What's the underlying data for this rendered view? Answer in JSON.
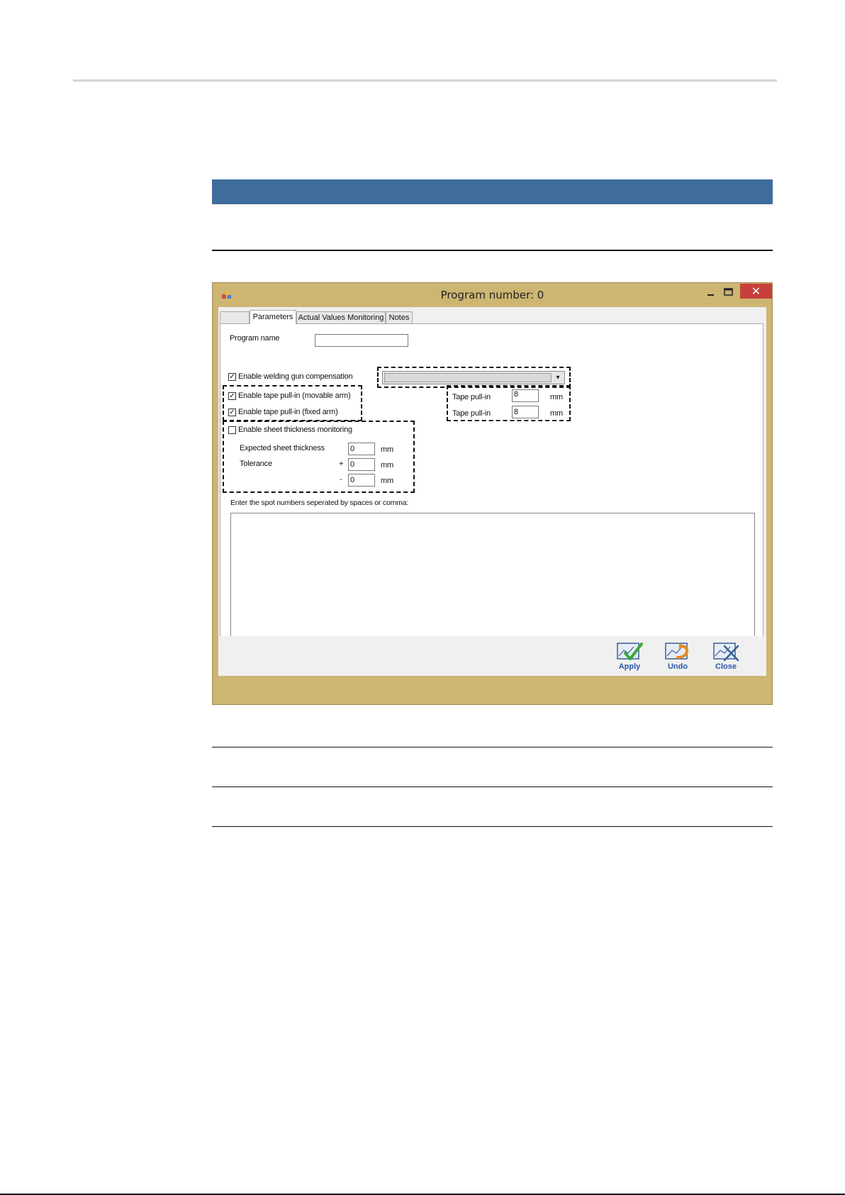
{
  "window": {
    "title": "Program number: 0",
    "close_glyph": "✕"
  },
  "tabs": [
    {
      "label": ""
    },
    {
      "label": "Parameters"
    },
    {
      "label": "Actual Values Monitoring"
    },
    {
      "label": "Notes"
    }
  ],
  "form": {
    "program_name_label": "Program name",
    "program_name_value": "",
    "welding_gun_label": "Enable welding gun compensation",
    "welding_gun_checked": true,
    "tape_movable_label": "Enable tape pull-in (movable arm)",
    "tape_movable_checked": true,
    "tape_fixed_label": "Enable tape pull-in (fixed arm)",
    "tape_fixed_checked": true,
    "tape_pullin_label_1": "Tape pull-in",
    "tape_pullin_value_1": "8",
    "tape_pullin_unit_1": "mm",
    "tape_pullin_label_2": "Tape pull-in",
    "tape_pullin_value_2": "8",
    "tape_pullin_unit_2": "mm",
    "sheet_label": "Enable sheet thickness monitoring",
    "sheet_checked": false,
    "expected_label": "Expected sheet thickness",
    "expected_value": "0",
    "expected_unit": "mm",
    "tolerance_label": "Tolerance",
    "tol_plus_sign": "+",
    "tol_plus_value": "0",
    "tol_plus_unit": "mm",
    "tol_minus_sign": "-",
    "tol_minus_value": "0",
    "tol_minus_unit": "mm",
    "spot_label": "Enter the spot numbers seperated by spaces or comma:",
    "spot_value": ""
  },
  "toolbar": {
    "apply_label": "Apply",
    "undo_label": "Undo",
    "close_label": "Close"
  },
  "colors": {
    "title_bar": "#cdb572",
    "header_band": "#3f6d9b",
    "close_red": "#c7403a",
    "toolbar_text": "#2b56a8"
  }
}
